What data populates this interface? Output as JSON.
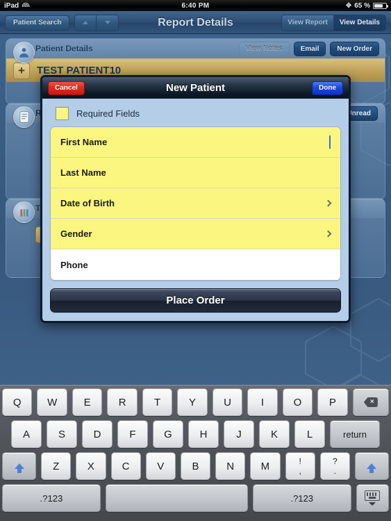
{
  "status_bar": {
    "device": "iPad",
    "wifi_icon": "wifi-icon",
    "time": "6:40 PM",
    "bluetooth_icon": "bluetooth-icon",
    "battery_percent": "65 %",
    "battery_icon": "battery-icon"
  },
  "nav_bar": {
    "back_button": "Patient Search",
    "prev_icon": "arrow-up-icon",
    "next_icon": "arrow-down-icon",
    "title": "Report Details",
    "segments": [
      {
        "label": "View Report",
        "selected": false
      },
      {
        "label": "View Details",
        "selected": true
      }
    ]
  },
  "background": {
    "patient_panel": {
      "icon": "patient-icon",
      "title": "Patient Details",
      "buttons": [
        {
          "label": "View Notes",
          "disabled": true
        },
        {
          "label": "Email",
          "disabled": false
        },
        {
          "label": "New Order",
          "disabled": false
        }
      ],
      "patient_name": "TEST PATIENT10",
      "add_button": "+"
    },
    "reports_panel": {
      "icon": "report-icon",
      "title": "Re",
      "mark_unread_button": "k Unread"
    },
    "tests_panel": {
      "icon": "tests-icon",
      "title": "Te",
      "add_button": "+"
    }
  },
  "modal": {
    "cancel_button": "Cancel",
    "title": "New Patient",
    "done_button": "Done",
    "legend": {
      "swatch_color": "#faf57e",
      "label": "Required Fields"
    },
    "fields": [
      {
        "label": "First Name",
        "required": true,
        "accessory": "caret"
      },
      {
        "label": "Last Name",
        "required": true,
        "accessory": "none"
      },
      {
        "label": "Date of Birth",
        "required": true,
        "accessory": "chevron"
      },
      {
        "label": "Gender",
        "required": true,
        "accessory": "chevron"
      },
      {
        "label": "Phone",
        "required": false,
        "accessory": "none"
      }
    ],
    "submit_button": "Place Order"
  },
  "keyboard": {
    "row1": [
      "Q",
      "W",
      "E",
      "R",
      "T",
      "Y",
      "U",
      "I",
      "O",
      "P"
    ],
    "backspace_icon": "backspace-icon",
    "row2": [
      "A",
      "S",
      "D",
      "F",
      "G",
      "H",
      "J",
      "K",
      "L"
    ],
    "return_key": "return",
    "shift_icon": "shift-icon",
    "row3": [
      "Z",
      "X",
      "C",
      "V",
      "B",
      "N",
      "M"
    ],
    "punct_keys": [
      {
        "top": "!",
        "bottom": ","
      },
      {
        "top": "?",
        "bottom": "."
      }
    ],
    "num_key_left": ".?123",
    "space_key": "",
    "num_key_right": ".?123",
    "hide_keyboard_icon": "hide-keyboard-icon"
  }
}
